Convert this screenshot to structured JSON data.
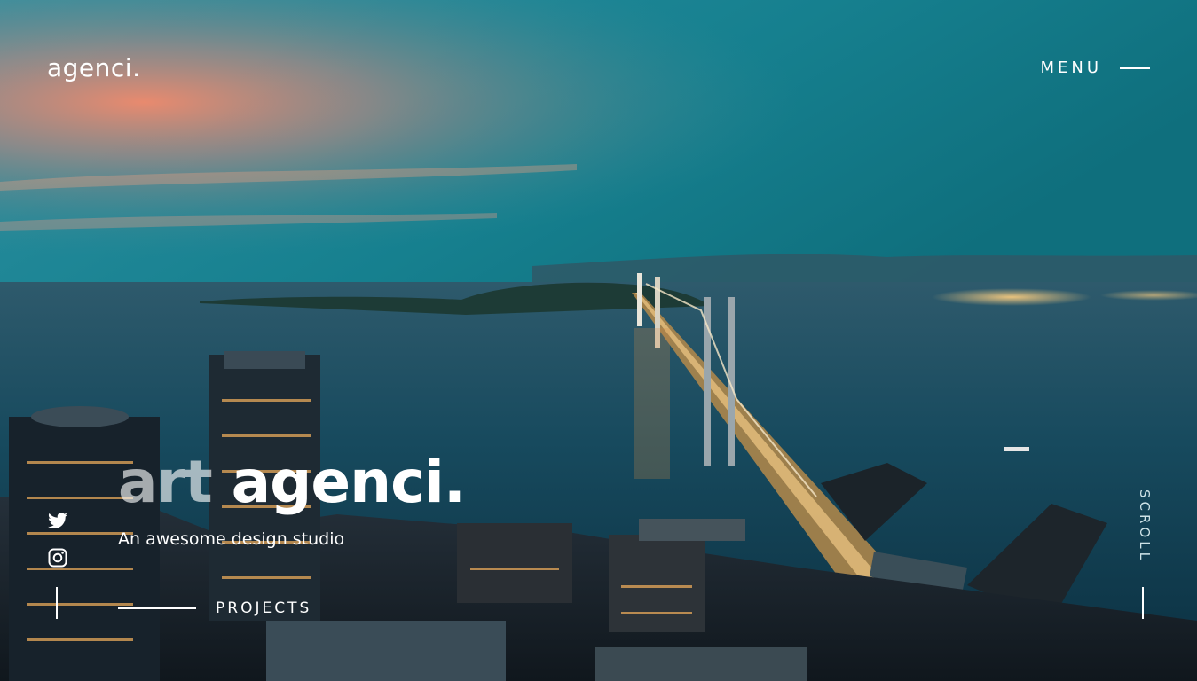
{
  "header": {
    "logo_text": "agenci.",
    "menu_label": "MENU"
  },
  "hero": {
    "title_part1": "art",
    "title_part2": "agenci.",
    "subtitle": "An awesome design studio",
    "projects_label": "PROJECTS"
  },
  "social": [
    {
      "icon": "twitter-icon"
    },
    {
      "icon": "instagram-icon"
    }
  ],
  "scroll_label": "SCROLL",
  "colors": {
    "sky_top": "#1a8b95",
    "sunset": "#f08a6a",
    "water": "#0e3c4e",
    "text": "#ffffff"
  }
}
